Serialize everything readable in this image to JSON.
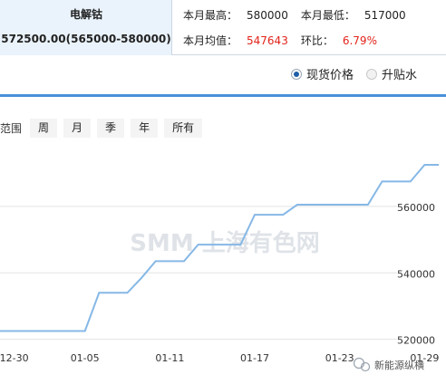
{
  "product": {
    "name": "电解钴",
    "price": "572500.00(565000-580000)"
  },
  "stats": {
    "month_high_label": "本月最高：",
    "month_high": "580000",
    "month_low_label": "本月最低：",
    "month_low": "517000",
    "month_avg_label": "本月均值：",
    "month_avg": "547643",
    "mom_label": "环比：",
    "mom": "6.79%"
  },
  "price_type": {
    "options": [
      {
        "label": "现货价格",
        "checked": true
      },
      {
        "label": "升贴水",
        "checked": false
      }
    ]
  },
  "range": {
    "label": "范围",
    "buttons": [
      "周",
      "月",
      "季",
      "年",
      "所有"
    ]
  },
  "colors": {
    "line": "#86b8e6",
    "accent": "#4a90d9",
    "negative": "#e2231a"
  },
  "chart_data": {
    "type": "line",
    "x": [
      "12-29",
      "12-30",
      "12-31",
      "01-02",
      "01-03",
      "01-04",
      "01-05",
      "01-06",
      "01-07",
      "01-08",
      "01-09",
      "01-10",
      "01-11",
      "01-12",
      "01-13",
      "01-14",
      "01-15",
      "01-16",
      "01-17",
      "01-18",
      "01-19",
      "01-20",
      "01-21",
      "01-22",
      "01-23",
      "01-24",
      "01-25",
      "01-26",
      "01-27",
      "01-28",
      "01-29",
      "01-30"
    ],
    "series": [
      {
        "values": [
          522500,
          522500,
          522500,
          522500,
          522500,
          522500,
          522500,
          534000,
          534000,
          534000,
          538500,
          543500,
          543500,
          543500,
          548500,
          548500,
          548500,
          548500,
          557500,
          557500,
          557500,
          560500,
          560500,
          560500,
          560500,
          560500,
          560500,
          567500,
          567500,
          567500,
          572500,
          572500
        ]
      }
    ],
    "x_tick_labels": [
      "12-30",
      "01-05",
      "01-11",
      "01-17",
      "01-23",
      "01-29"
    ],
    "y_tick_labels": [
      "520000",
      "540000",
      "560000"
    ],
    "ylim": [
      518000,
      578500
    ],
    "grid": true,
    "watermark": "SMM 上海有色网",
    "footer_brand": "新能源纵横"
  }
}
